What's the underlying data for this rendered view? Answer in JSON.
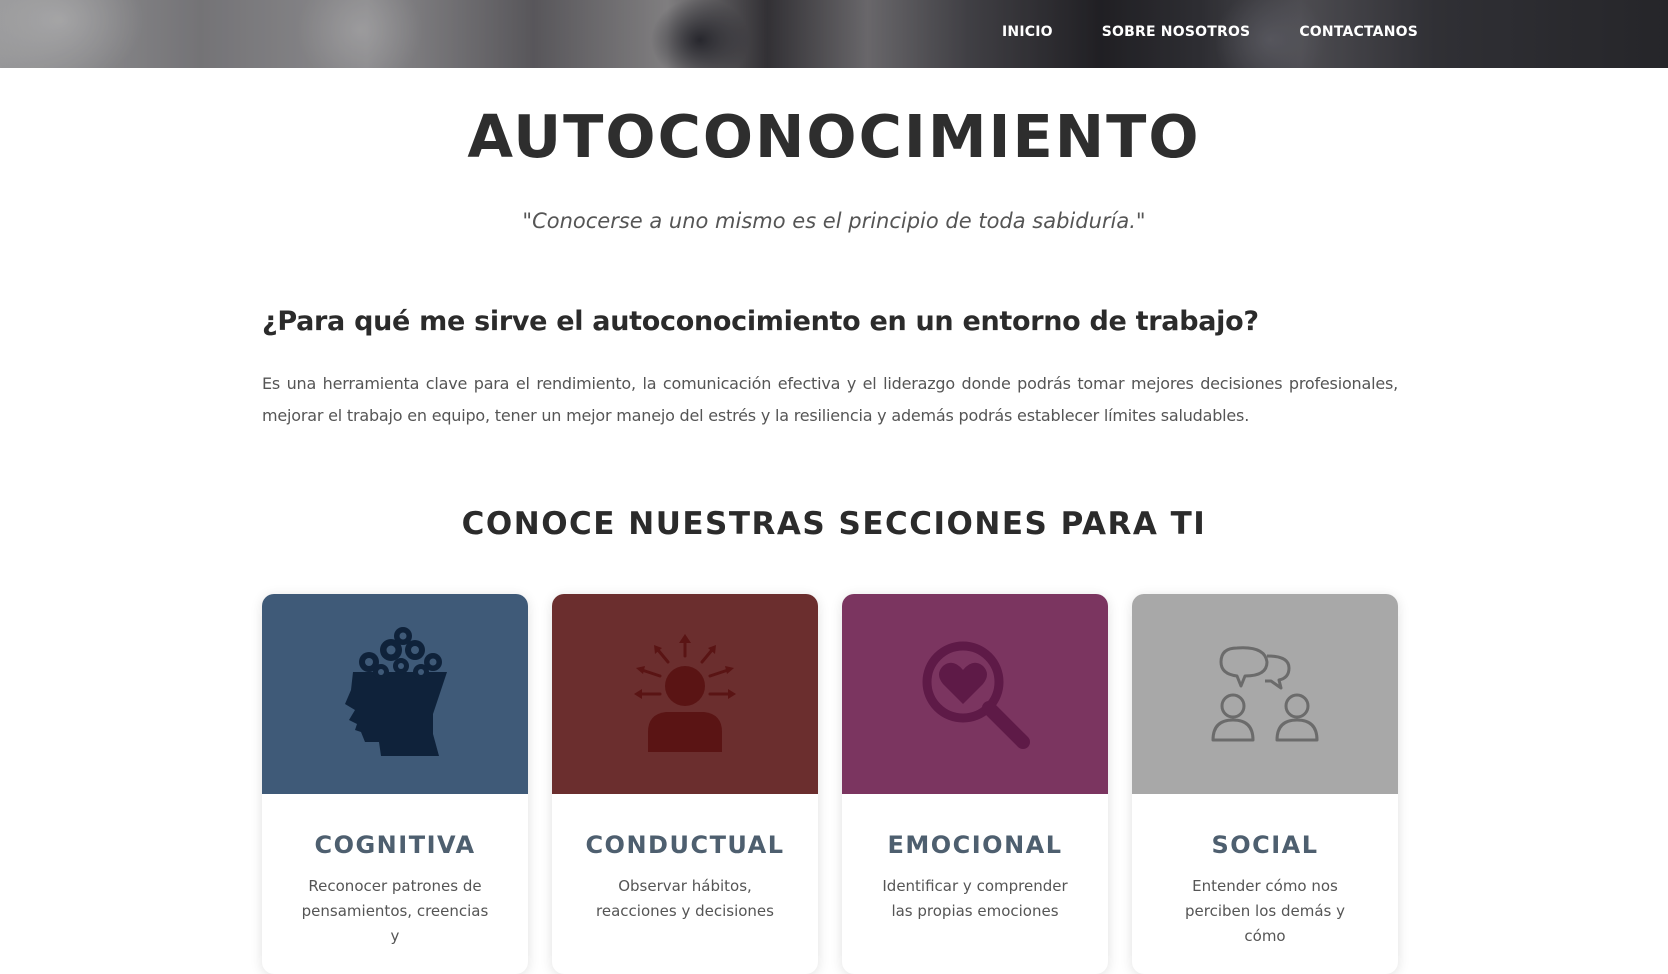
{
  "nav": {
    "items": [
      {
        "label": "INICIO"
      },
      {
        "label": "SOBRE NOSOTROS"
      },
      {
        "label": "CONTACTANOS"
      }
    ]
  },
  "title": "AUTOCONOCIMIENTO",
  "quote": "\"Conocerse a uno mismo es el principio de toda sabiduría.\"",
  "question": {
    "heading": "¿Para qué me sirve el autoconocimiento en un entorno de trabajo?",
    "body": "Es una herramienta clave para el rendimiento, la comunicación efectiva y el liderazgo donde podrás tomar mejores decisiones profesionales, mejorar el trabajo en equipo, tener un mejor manejo del estrés y la resiliencia y además podrás establecer límites saludables."
  },
  "sections": {
    "title": "CONOCE NUESTRAS SECCIONES PARA TI",
    "cards": [
      {
        "title": "COGNITIVA",
        "text": "Reconocer patrones de pensamientos, creencias y",
        "color": "#3f5a78",
        "icon": "head-gears-icon"
      },
      {
        "title": "CONDUCTUAL",
        "text": "Observar hábitos, reacciones y decisiones",
        "color": "#6b2e2e",
        "icon": "person-arrows-icon"
      },
      {
        "title": "EMOCIONAL",
        "text": "Identificar y comprender las propias emociones",
        "color": "#7b3560",
        "icon": "heart-magnifier-icon"
      },
      {
        "title": "SOCIAL",
        "text": "Entender cómo nos perciben los demás y cómo",
        "color": "#a8a8a8",
        "icon": "people-chat-icon"
      }
    ]
  }
}
